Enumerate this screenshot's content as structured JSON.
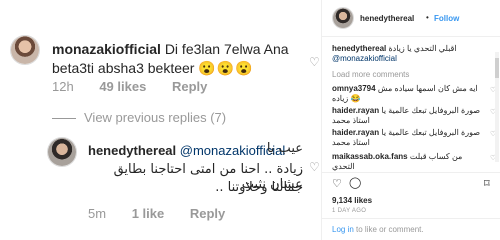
{
  "left": {
    "comment1": {
      "username": "monazakiofficial",
      "text": "Di fe3lan 7elwa Ana beta3ti absha3 bekteer",
      "emojis": "😮😮😮",
      "time": "12h",
      "likes": "49 likes",
      "reply": "Reply"
    },
    "view_previous": "View previous replies (7)",
    "comment2": {
      "username": "henedythereal",
      "mention": "@monazakiofficial",
      "line1": "عيب يا",
      "line2": "زيادة .. احنا من امتى احتاجنا بطايق عشان نثبت",
      "line3": "جمالنا وحلاوتنا ..",
      "time": "5m",
      "likes": "1 like",
      "reply": "Reply"
    }
  },
  "right": {
    "header": {
      "username": "henedythereal",
      "dot": "•",
      "follow": "Follow"
    },
    "caption": {
      "username": "henedythereal",
      "line1": "اقبلي التحدي يا زيادة",
      "mention": "@monazakiofficial"
    },
    "load_more": "Load more comments",
    "comments": [
      {
        "username": "omnya3794",
        "text": "ايه مش كان اسمها سياده مش زياده 😂"
      },
      {
        "username": "haider.rayan",
        "text": "صورة البروفايل تبعك عالمية يا استاذ محمد"
      },
      {
        "username": "haider.rayan",
        "text": "صورة البروفايل تبعك عالمية يا استاذ محمد"
      },
      {
        "username": "maikassab.oka.fans",
        "text": "من كساب قبلت التحدي"
      }
    ],
    "likes": "9,134 likes",
    "date": "1 DAY AGO",
    "login": {
      "link": "Log in",
      "rest": " to like or comment."
    }
  }
}
